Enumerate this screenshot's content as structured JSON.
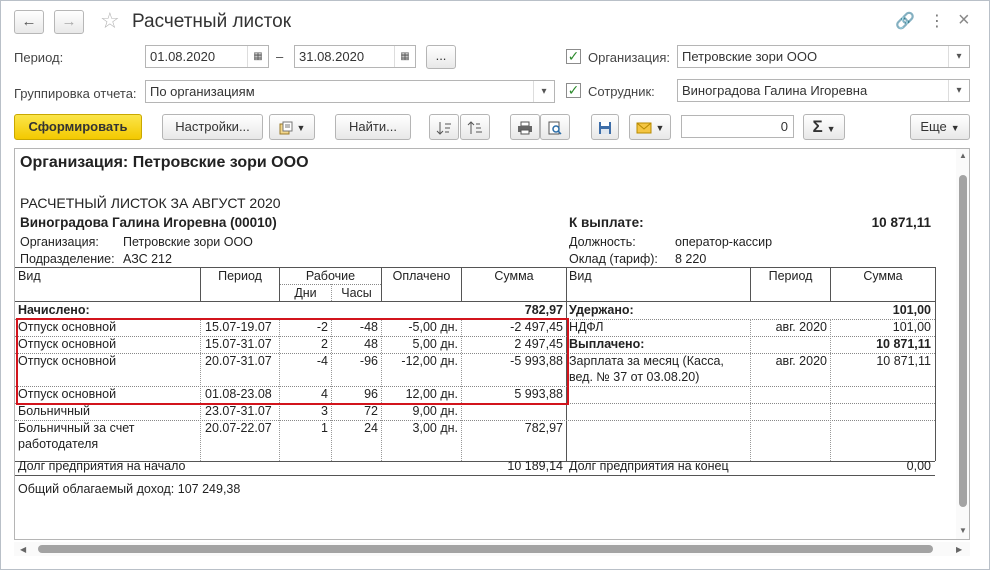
{
  "window": {
    "title": "Расчетный листок",
    "back_icon": "←",
    "forward_icon": "→",
    "star_icon": "☆",
    "link_icon": "🔗",
    "more_icon": "⋮",
    "close_icon": "×"
  },
  "form": {
    "period_label": "Период:",
    "date_from": "01.08.2020",
    "dash": "–",
    "date_to": "31.08.2020",
    "more_dots": "...",
    "grouping_label": "Группировка отчета:",
    "grouping_value": "По организациям",
    "org_label": "Организация:",
    "org_value": "Петровские зори ООО",
    "employee_label": "Сотрудник:",
    "employee_value": "Виноградова Галина Игоревна",
    "checkmark": "✓",
    "calendar_icon": "▦",
    "dropdown_icon": "▾"
  },
  "toolbar": {
    "generate": "Сформировать",
    "settings": "Настройки...",
    "find": "Найти...",
    "number_value": "0",
    "sum_icon": "Σ",
    "more": "Еще"
  },
  "report": {
    "org_heading": "Организация: Петровские зори ООО",
    "slip_title": "РАСЧЕТНЫЙ ЛИСТОК ЗА АВГУСТ 2020",
    "employee_name": "Виноградова Галина Игоревна (00010)",
    "org_label": "Организация:",
    "org_value": "Петровские зори ООО",
    "dept_label": "Подразделение:",
    "dept_value": "АЗС 212",
    "to_pay_label": "К выплате:",
    "to_pay_value": "10 871,11",
    "position_label": "Должность:",
    "position_value": "оператор-кассир",
    "salary_label": "Оклад (тариф):",
    "salary_value": "8 220",
    "left_headers": {
      "kind": "Вид",
      "period": "Период",
      "working": "Рабочие",
      "days": "Дни",
      "hours": "Часы",
      "paid": "Оплачено",
      "sum": "Сумма"
    },
    "right_headers": {
      "kind": "Вид",
      "period": "Период",
      "sum": "Сумма"
    },
    "accrued_label": "Начислено:",
    "accrued_total": "782,97",
    "left_rows": [
      {
        "kind": "Отпуск основной",
        "period": "15.07-19.07",
        "days": "-2",
        "hours": "-48",
        "paid": "-5,00 дн.",
        "sum": "-2 497,45"
      },
      {
        "kind": "Отпуск основной",
        "period": "15.07-31.07",
        "days": "2",
        "hours": "48",
        "paid": "5,00 дн.",
        "sum": "2 497,45"
      },
      {
        "kind": "Отпуск основной",
        "period": "20.07-31.07",
        "days": "-4",
        "hours": "-96",
        "paid": "-12,00 дн.",
        "sum": "-5 993,88"
      },
      {
        "kind": "Отпуск основной",
        "period": "01.08-23.08",
        "days": "4",
        "hours": "96",
        "paid": "12,00 дн.",
        "sum": "5 993,88"
      },
      {
        "kind": "Больничный",
        "period": "23.07-31.07",
        "days": "3",
        "hours": "72",
        "paid": "9,00 дн.",
        "sum": ""
      },
      {
        "kind": "Больничный за счет",
        "kind2": "работодателя",
        "period": "20.07-22.07",
        "days": "1",
        "hours": "24",
        "paid": "3,00 дн.",
        "sum": "782,97"
      }
    ],
    "withheld_label": "Удержано:",
    "withheld_total": "101,00",
    "ndfl_kind": "НДФЛ",
    "ndfl_period": "авг. 2020",
    "ndfl_sum": "101,00",
    "paid_label": "Выплачено:",
    "paid_total": "10 871,11",
    "salary_pay_kind": "Зарплата за месяц (Касса,",
    "salary_pay_kind2": "вед. № 37 от 03.08.20)",
    "salary_pay_period": "авг. 2020",
    "salary_pay_sum": "10 871,11",
    "debt_start_label": "Долг предприятия на начало",
    "debt_start_value": "10 189,14",
    "debt_end_label": "Долг предприятия на конец",
    "debt_end_value": "0,00",
    "taxable_income": "Общий облагаемый доход: 107 249,38"
  }
}
